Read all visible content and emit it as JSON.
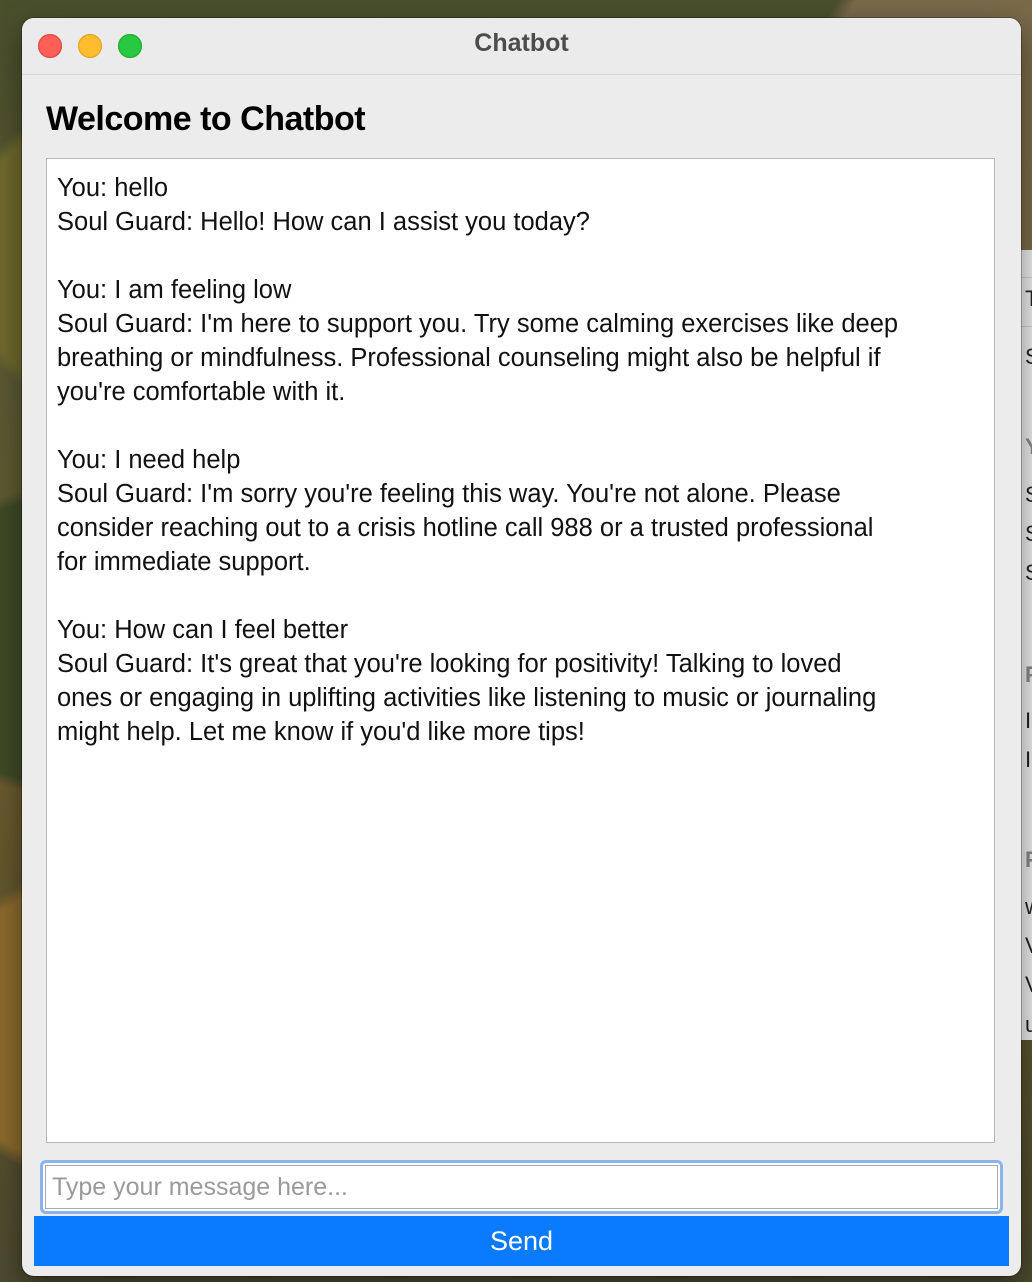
{
  "window": {
    "title": "Chatbot"
  },
  "header": {
    "title": "Welcome to Chatbot"
  },
  "chat": {
    "messages": [
      {
        "lines": [
          "You: hello",
          "Soul Guard: Hello! How can I assist you today?"
        ]
      },
      {
        "lines": [
          "You: I am feeling low",
          "Soul Guard: I'm here to support you. Try some calming exercises like deep",
          "breathing or mindfulness. Professional counseling might also be helpful if",
          "you're comfortable with it."
        ]
      },
      {
        "lines": [
          "You: I need help",
          "Soul Guard: I'm sorry you're feeling this way. You're not alone. Please",
          "consider reaching out to a crisis hotline call 988 or a trusted professional",
          "for immediate support."
        ]
      },
      {
        "lines": [
          "You: How can I feel better",
          "Soul Guard: It's great that you're looking for positivity! Talking to loved",
          "ones or engaging in uplifting activities like listening to music or journaling",
          "might help. Let me know if you'd like more tips!"
        ]
      }
    ]
  },
  "input": {
    "value": "",
    "placeholder": "Type your message here..."
  },
  "send": {
    "label": "Send"
  },
  "background_window": {
    "fragments": [
      "T",
      "S",
      "Y",
      "S",
      "S",
      "S",
      "P",
      "I",
      "I",
      "P",
      "w",
      "V",
      "V",
      "u"
    ]
  },
  "colors": {
    "accent": "#0a7aff",
    "close": "#fe5f57",
    "minimize": "#febc2e",
    "zoom": "#28c840"
  }
}
